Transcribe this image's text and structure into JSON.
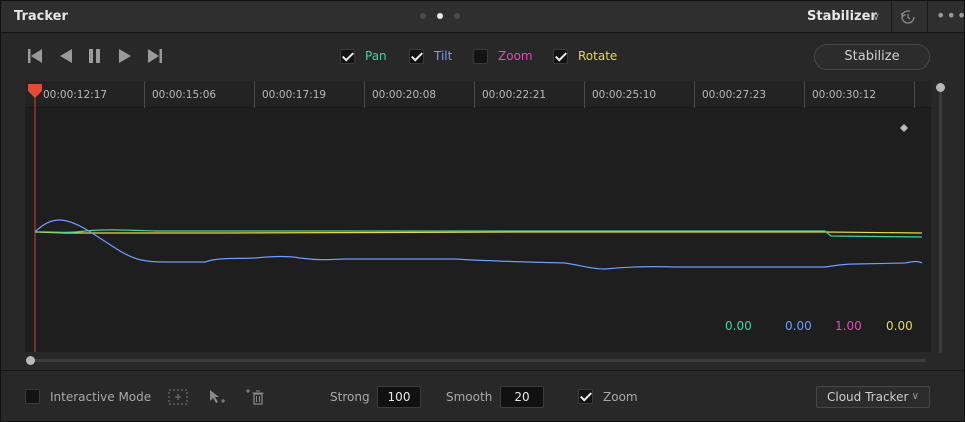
{
  "header": {
    "title": "Tracker",
    "mode": "Stabilizer",
    "mode_chevron": "chevron-down-icon",
    "page_dots": [
      false,
      true,
      false
    ]
  },
  "transport": {
    "icons": [
      "skip-to-start-icon",
      "play-reverse-icon",
      "pause-icon",
      "play-icon",
      "skip-to-end-icon"
    ]
  },
  "channels": [
    {
      "label": "Pan",
      "checked": true,
      "color": "#3fd4a0"
    },
    {
      "label": "Tilt",
      "checked": true,
      "color": "#6f9cff"
    },
    {
      "label": "Zoom",
      "checked": false,
      "color": "#e64ab8"
    },
    {
      "label": "Rotate",
      "checked": true,
      "color": "#e6d94a"
    }
  ],
  "stabilize_label": "Stabilize",
  "timeline": {
    "timecodes": [
      "00:00:12:17",
      "00:00:15:06",
      "00:00:17:19",
      "00:00:20:08",
      "00:00:22:21",
      "00:00:25:10",
      "00:00:27:23",
      "00:00:30:12"
    ]
  },
  "readouts": {
    "pan": "0.00",
    "tilt": "0.00",
    "zoom": "1.00",
    "rotate": "0.00"
  },
  "colors": {
    "pan": "#3fd4a0",
    "tilt": "#6f9cff",
    "zoom": "#e64ab8",
    "rotate": "#e6d94a",
    "playhead": "#e24a3a"
  },
  "footer": {
    "interactive_mode_label": "Interactive Mode",
    "interactive_mode_checked": false,
    "strong_label": "Strong",
    "strong_value": "100",
    "smooth_label": "Smooth",
    "smooth_value": "20",
    "zoom_label": "Zoom",
    "zoom_checked": true,
    "tracker_select": "Cloud Tracker"
  }
}
